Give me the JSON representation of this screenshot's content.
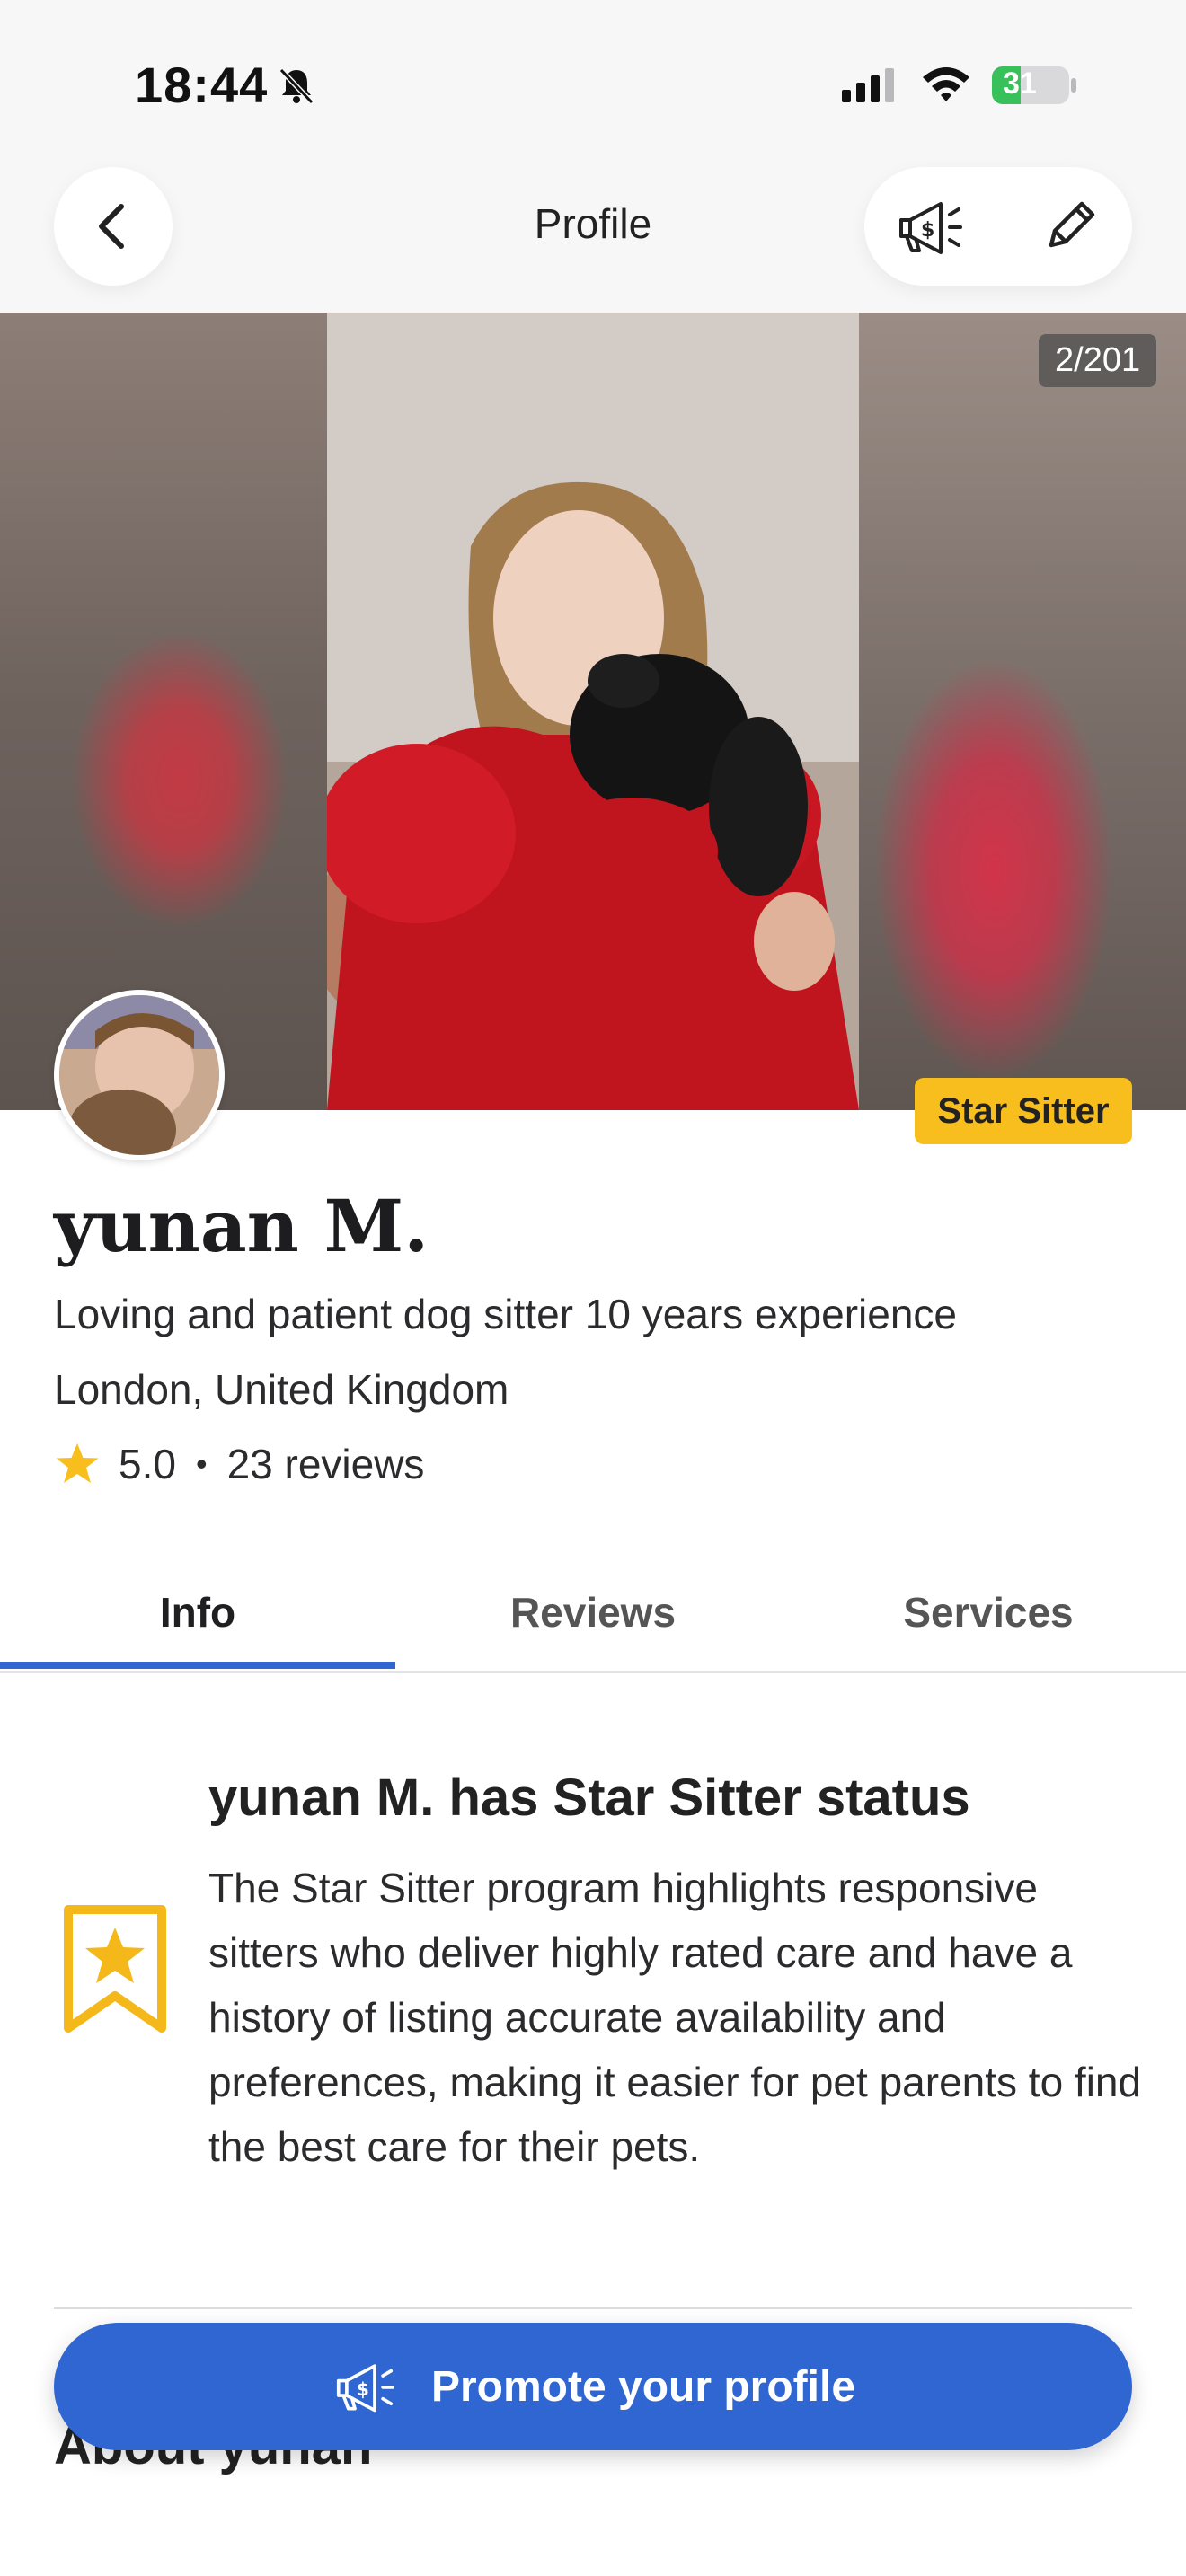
{
  "status_bar": {
    "time": "18:44",
    "battery": "31"
  },
  "header": {
    "title": "Profile"
  },
  "carousel": {
    "counter": "2/201"
  },
  "profile": {
    "badge": "Star Sitter",
    "name": "yunan M.",
    "tagline": "Loving and patient dog sitter 10 years experience",
    "location": "London, United Kingdom",
    "rating": "5.0",
    "separator": "•",
    "reviews": "23 reviews"
  },
  "tabs": [
    {
      "label": "Info",
      "active": true
    },
    {
      "label": "Reviews",
      "active": false
    },
    {
      "label": "Services",
      "active": false
    }
  ],
  "star_status": {
    "title": "yunan M. has Star Sitter status",
    "body": "The Star Sitter program highlights responsive sitters who deliver highly rated care and have a history of listing accurate availability and preferences, making it easier for pet parents to find the best care for their pets."
  },
  "about": {
    "title": "About yunan"
  },
  "promote": {
    "label": "Promote your profile"
  },
  "colors": {
    "accent": "#2f66d1",
    "badge": "#f8be1e",
    "star": "#f8be1e"
  },
  "icons": [
    "bell-off-icon",
    "signal-icon",
    "wifi-icon",
    "battery-icon",
    "back-arrow-icon",
    "megaphone-dollar-icon",
    "pencil-icon",
    "star-icon",
    "star-sitter-badge-icon"
  ]
}
